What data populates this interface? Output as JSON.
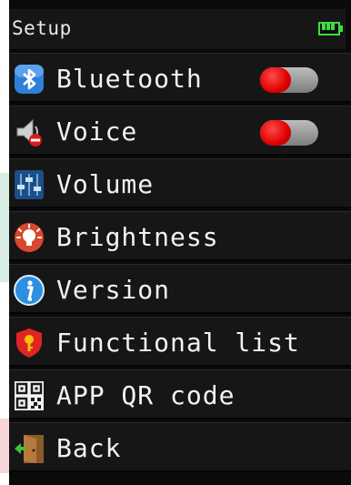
{
  "header": {
    "title": "Setup",
    "battery": {
      "level": 1.0,
      "color": "#3fdc3f"
    }
  },
  "menu": {
    "items": [
      {
        "label": "Bluetooth",
        "icon": "bluetooth-icon",
        "toggle": {
          "state": "off"
        }
      },
      {
        "label": "Voice",
        "icon": "speaker-muted-icon",
        "toggle": {
          "state": "off"
        }
      },
      {
        "label": "Volume",
        "icon": "equalizer-icon"
      },
      {
        "label": "Brightness",
        "icon": "lightbulb-icon"
      },
      {
        "label": "Version",
        "icon": "info-icon"
      },
      {
        "label": "Functional list",
        "icon": "shield-key-icon"
      },
      {
        "label": "APP QR code",
        "icon": "qr-code-icon"
      },
      {
        "label": "Back",
        "icon": "exit-door-icon"
      }
    ]
  },
  "colors": {
    "toggle_knob": "#e00000",
    "toggle_track": "#9e9e9e",
    "background": "#161616",
    "text": "#f2f2f2"
  }
}
